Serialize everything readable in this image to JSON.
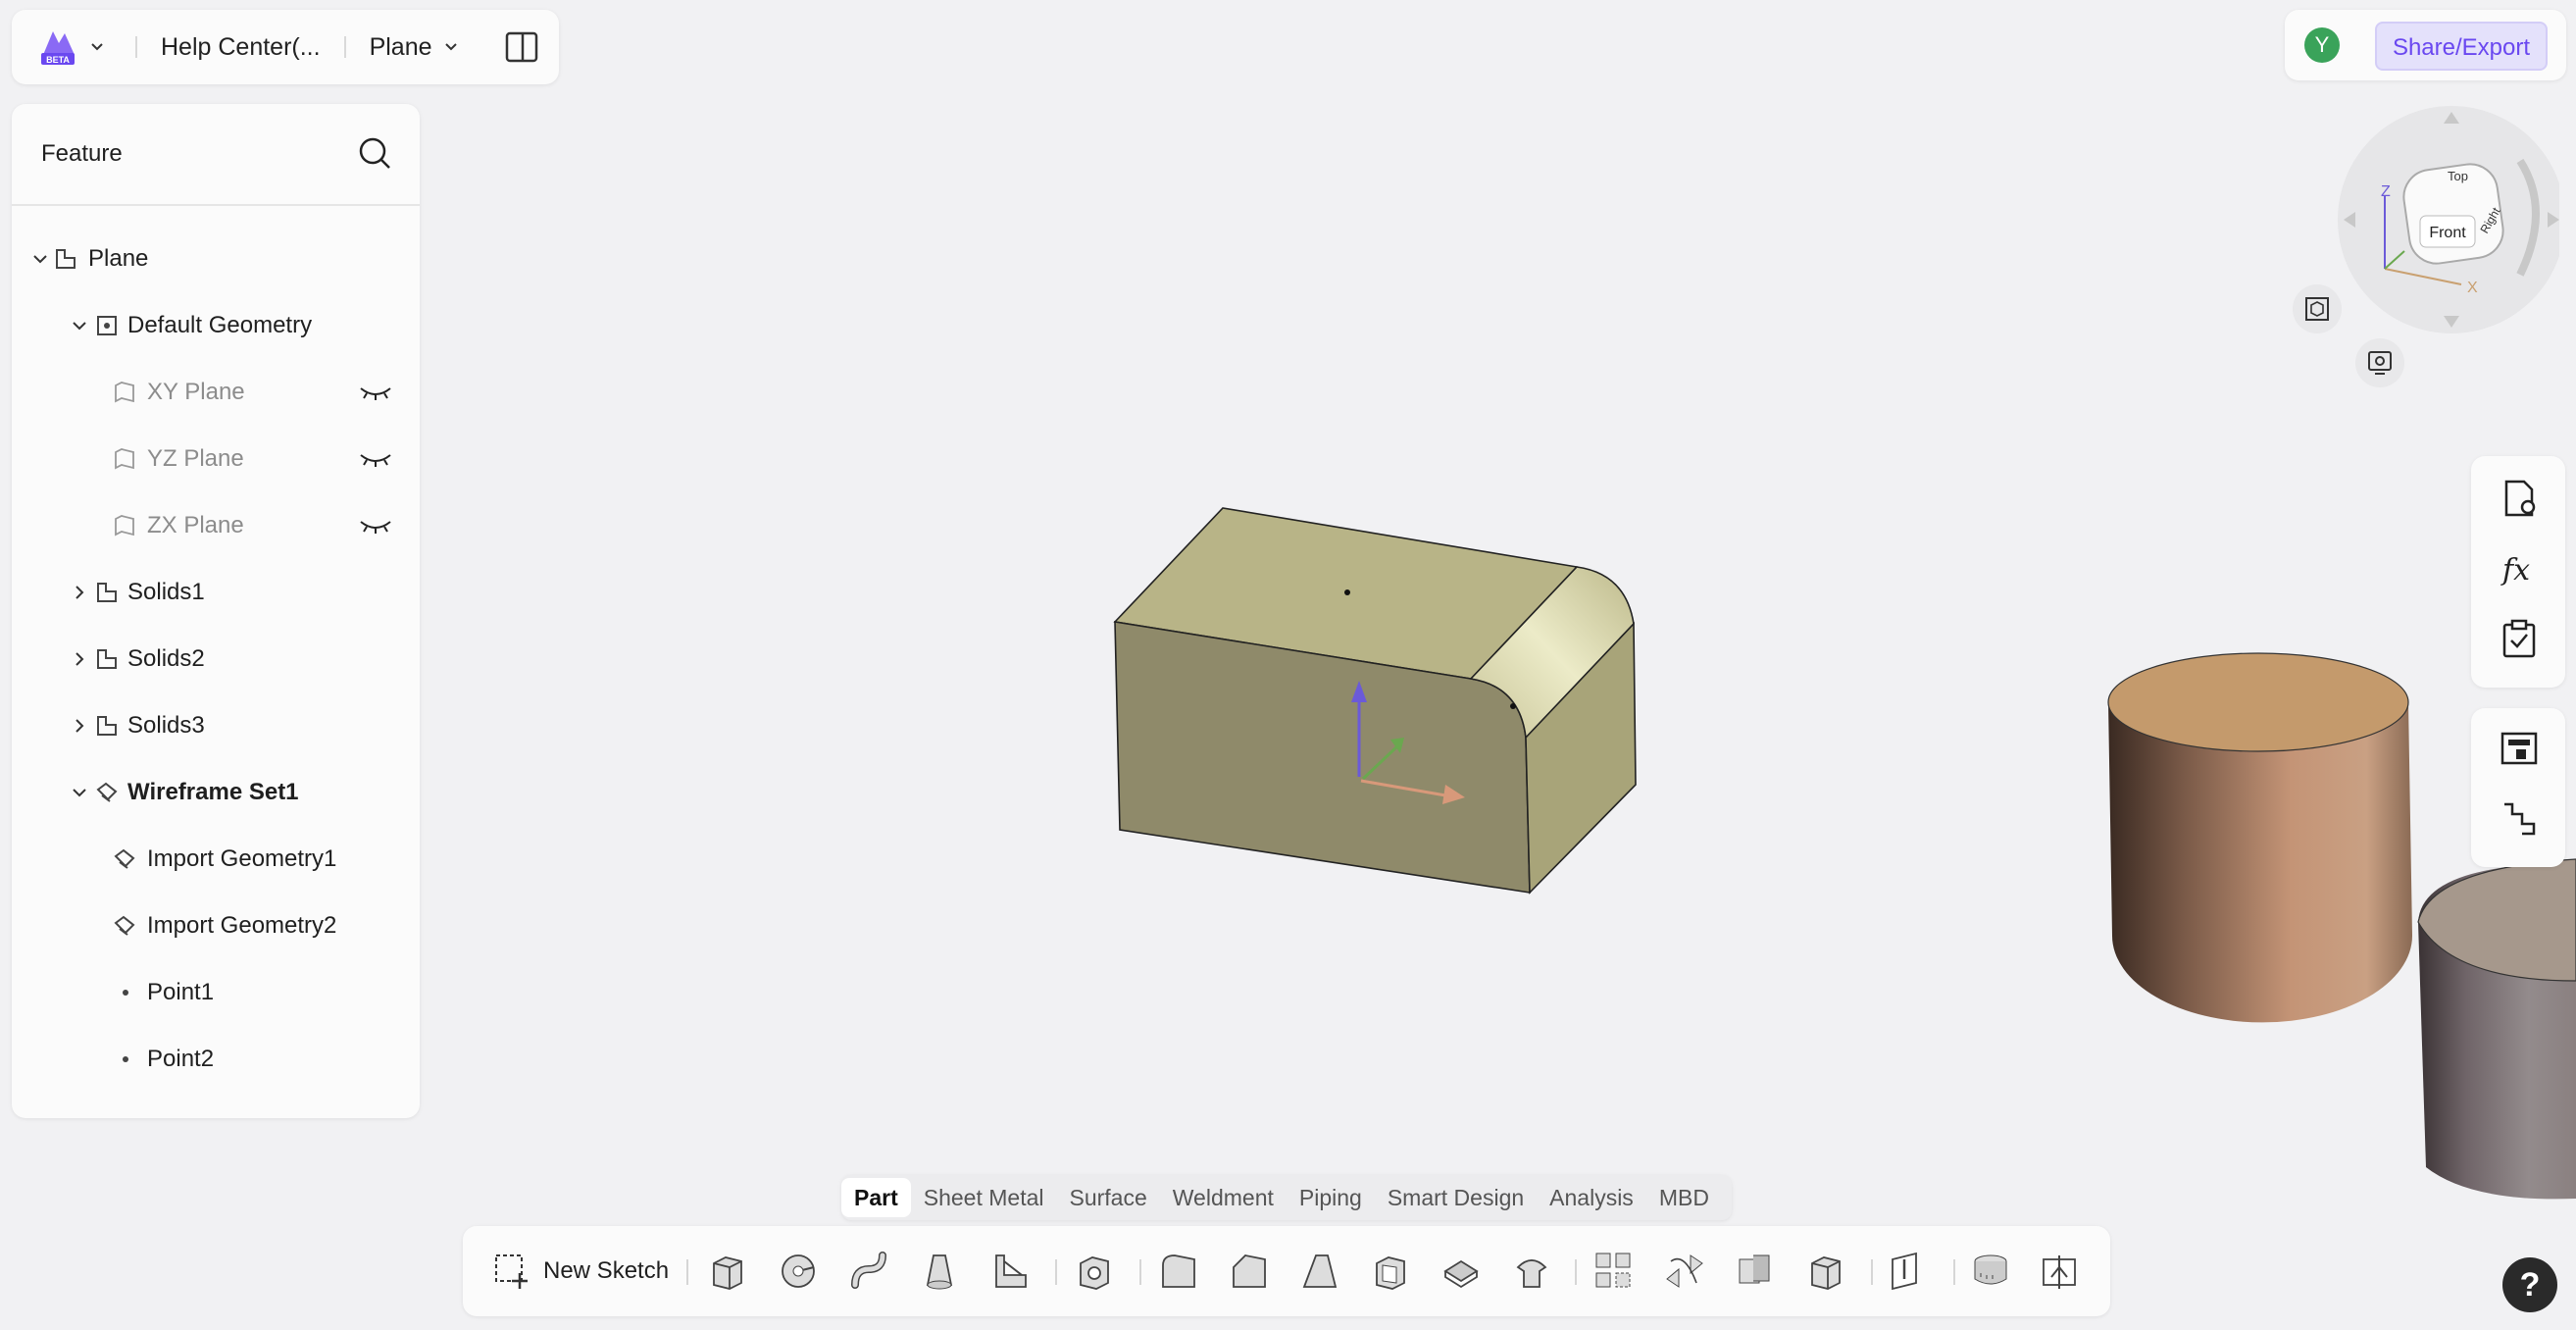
{
  "header": {
    "logo_badge": "BETA",
    "help_center": "Help Center(...",
    "document": "Plane"
  },
  "sidebar": {
    "title": "Feature",
    "items": [
      {
        "label": "Plane"
      },
      {
        "label": "Default Geometry"
      },
      {
        "label": "XY Plane"
      },
      {
        "label": "YZ Plane"
      },
      {
        "label": "ZX Plane"
      },
      {
        "label": "Solids1"
      },
      {
        "label": "Solids2"
      },
      {
        "label": "Solids3"
      },
      {
        "label": "Wireframe Set1"
      },
      {
        "label": "Import Geometry1"
      },
      {
        "label": "Import Geometry2"
      },
      {
        "label": "Point1"
      },
      {
        "label": "Point2"
      }
    ]
  },
  "top_right": {
    "avatar": "Y",
    "share_label": "Share/Export"
  },
  "viewcube": {
    "top": "Top",
    "front": "Front",
    "right": "Right",
    "axis_x": "X",
    "axis_z": "Z"
  },
  "tabs": [
    "Part",
    "Sheet Metal",
    "Surface",
    "Weldment",
    "Piping",
    "Smart Design",
    "Analysis",
    "MBD"
  ],
  "toolbar": {
    "new_sketch": "New Sketch"
  },
  "help": "?",
  "colors": {
    "accent": "#6a48f0",
    "box_front": "#8f8a6a",
    "box_top": "#b8b487",
    "box_side": "#a8a479",
    "cylinder_top": "#c49a6c",
    "cylinder2_top": "#a6988c"
  }
}
